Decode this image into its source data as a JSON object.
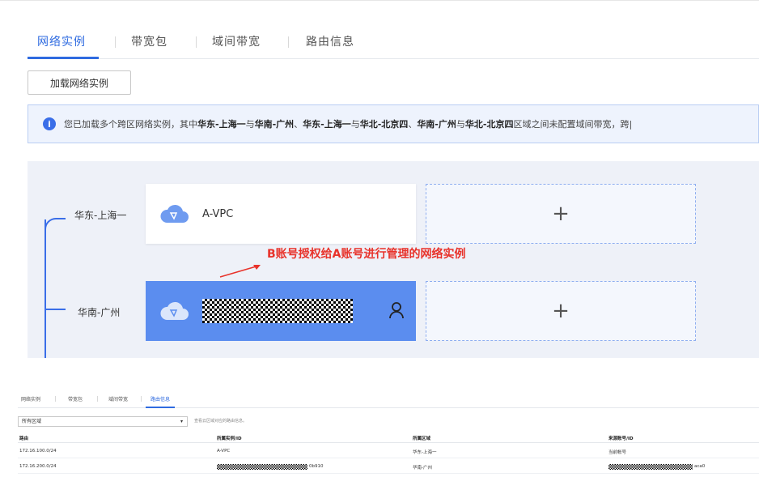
{
  "top_tabs": [
    {
      "label": "网络实例",
      "active": true
    },
    {
      "label": "带宽包",
      "active": false
    },
    {
      "label": "域间带宽",
      "active": false
    },
    {
      "label": "路由信息",
      "active": false
    }
  ],
  "load_button": "加载网络实例",
  "notice": {
    "icon": "info-icon",
    "prefix": "您已加载多个跨区网络实例，其中",
    "r1": "华东-上海一",
    "and1": "与",
    "r2": "华南-广州",
    "sep1": "、",
    "r3": "华东-上海一",
    "and2": "与",
    "r4": "华北-北京四",
    "sep2": "、",
    "r5": "华南-广州",
    "and3": "与",
    "r6": "华北-北京四",
    "suffix": "区域之间未配置域间带宽，跨|"
  },
  "regions": [
    {
      "label": "华东-上海一",
      "instance": "A-VPC",
      "add": "+"
    },
    {
      "label": "华南-广州",
      "instance": "",
      "add": "+"
    }
  ],
  "annotation": "B账号授权给A账号进行管理的网络实例",
  "colors": {
    "accent": "#2f6be0",
    "selected_card": "#5b8def",
    "annotation": "#e8322a"
  },
  "bottom": {
    "tabs": [
      "网络实例",
      "带宽包",
      "域间带宽",
      "路由信息"
    ],
    "active_tab": "路由信息",
    "select_value": "所有区域",
    "hint": "查看云区域对应的路由信息。",
    "headers": [
      "路由",
      "所属实例/ID",
      "所属区域",
      "来源账号/ID"
    ],
    "rows": [
      {
        "route": "172.16.100.0/24",
        "instance": "A-VPC",
        "region": "华东-上海一",
        "account": "当前帐号"
      },
      {
        "route": "172.16.200.0/24",
        "instance_suffix": "0b910",
        "region": "华南-广州",
        "account_suffix": "aca0"
      }
    ]
  }
}
